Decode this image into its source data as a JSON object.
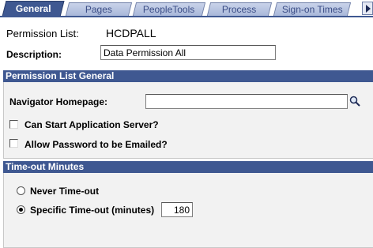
{
  "tabs": [
    {
      "label": "General",
      "active": true
    },
    {
      "label": "Pages",
      "active": false
    },
    {
      "label": "PeopleTools",
      "active": false
    },
    {
      "label": "Process",
      "active": false
    },
    {
      "label": "Sign-on Times",
      "active": false
    }
  ],
  "header": {
    "permission_list_label": "Permission List:",
    "permission_list_value": "HCDPALL",
    "description_label": "Description:",
    "description_value": "Data Permission All"
  },
  "general_group": {
    "title": "Permission List General",
    "navigator_label": "Navigator Homepage:",
    "navigator_value": "",
    "can_start_label": "Can Start Application Server?",
    "can_start_checked": false,
    "allow_password_label": "Allow Password to be Emailed?",
    "allow_password_checked": false
  },
  "timeout_group": {
    "title": "Time-out Minutes",
    "never_label": "Never Time-out",
    "never_selected": false,
    "specific_label": "Specific Time-out (minutes)",
    "specific_selected": true,
    "specific_value": "180"
  },
  "icons": {
    "lookup": "magnifier-icon",
    "tab_scroll": "arrow-right-icon"
  },
  "colors": {
    "tab_active": "#3f5891",
    "group_header": "#3f5891",
    "tab_inactive": "#b6c3e0"
  }
}
